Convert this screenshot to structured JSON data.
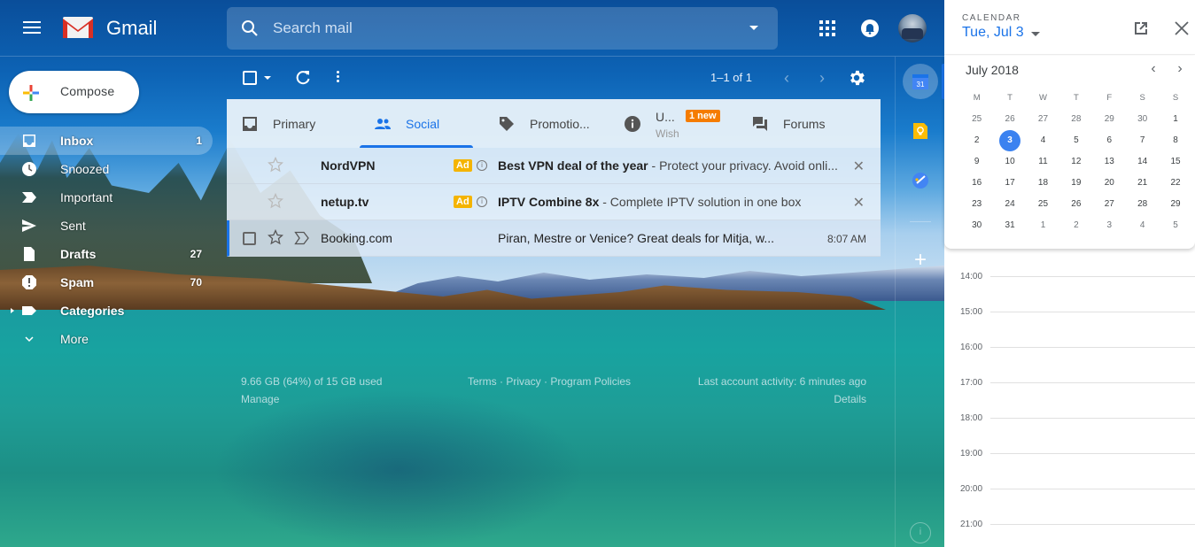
{
  "app": {
    "name": "Gmail"
  },
  "header": {
    "search_placeholder": "Search mail"
  },
  "compose": {
    "label": "Compose"
  },
  "sidebar": {
    "items": [
      {
        "label": "Inbox",
        "count": "1",
        "icon": "inbox-icon",
        "bold": true,
        "active": true
      },
      {
        "label": "Snoozed",
        "count": "",
        "icon": "clock-icon",
        "bold": false
      },
      {
        "label": "Important",
        "count": "",
        "icon": "important-icon",
        "bold": false
      },
      {
        "label": "Sent",
        "count": "",
        "icon": "send-icon",
        "bold": false
      },
      {
        "label": "Drafts",
        "count": "27",
        "icon": "draft-icon",
        "bold": true
      },
      {
        "label": "Spam",
        "count": "70",
        "icon": "spam-icon",
        "bold": true
      },
      {
        "label": "Categories",
        "count": "",
        "icon": "label-icon",
        "bold": true
      },
      {
        "label": "More",
        "count": "",
        "icon": "chevron-down-icon",
        "bold": false
      }
    ]
  },
  "toolbar": {
    "range": "1–1 of 1",
    "prev": "‹",
    "next": "›"
  },
  "tabs": [
    {
      "label": "Primary",
      "icon": "inbox-tab-icon"
    },
    {
      "label": "Social",
      "icon": "people-icon",
      "active": true
    },
    {
      "label": "Promotio...",
      "icon": "tag-icon"
    },
    {
      "label": "U...",
      "sub": "Wish",
      "badge": "1 new",
      "icon": "info-icon"
    },
    {
      "label": "Forums",
      "icon": "forum-icon"
    }
  ],
  "emails": [
    {
      "sender": "NordVPN",
      "ad": "Ad",
      "subject": "Best VPN deal of the year",
      "snippet": " - Protect your privacy. Avoid onli...",
      "unread": true,
      "is_ad": true
    },
    {
      "sender": "netup.tv",
      "ad": "Ad",
      "subject": "IPTV Combine 8x",
      "snippet": " - Complete IPTV solution in one box",
      "unread": true,
      "is_ad": true
    },
    {
      "sender": "Booking.com",
      "subject": "",
      "snippet": "Piran, Mestre or Venice? Great deals for Mitja, w...",
      "time": "8:07 AM",
      "unread": false,
      "is_ad": false
    }
  ],
  "footer": {
    "storage": "9.66 GB (64%) of 15 GB used",
    "storage_percent": 64,
    "manage": "Manage",
    "terms": "Terms",
    "privacy": "Privacy",
    "program_policies": "Program Policies",
    "separator": " · ",
    "activity": "Last account activity: 6 minutes ago",
    "details": "Details"
  },
  "rail": {
    "calendar_day": "31",
    "add": "+",
    "info": "i"
  },
  "calendar": {
    "eyebrow": "CALENDAR",
    "selected_date": "Tue, Jul 3",
    "month": "July 2018",
    "weekdays": [
      "M",
      "T",
      "W",
      "T",
      "F",
      "S",
      "S"
    ],
    "weeks": [
      [
        "25",
        "26",
        "27",
        "28",
        "29",
        "30",
        "1"
      ],
      [
        "2",
        "3",
        "4",
        "5",
        "6",
        "7",
        "8"
      ],
      [
        "9",
        "10",
        "11",
        "12",
        "13",
        "14",
        "15"
      ],
      [
        "16",
        "17",
        "18",
        "19",
        "20",
        "21",
        "22"
      ],
      [
        "23",
        "24",
        "25",
        "26",
        "27",
        "28",
        "29"
      ],
      [
        "30",
        "31",
        "1",
        "2",
        "3",
        "4",
        "5"
      ]
    ],
    "today": "3",
    "hours": [
      "14:00",
      "15:00",
      "16:00",
      "17:00",
      "18:00",
      "19:00",
      "20:00",
      "21:00"
    ],
    "colors": {
      "accent": "#1a73e8",
      "today": "#3b82f0"
    }
  },
  "colors": {
    "accent": "#1a73e8",
    "new_badge": "#f57c00",
    "ad_badge": "#f4b400"
  }
}
